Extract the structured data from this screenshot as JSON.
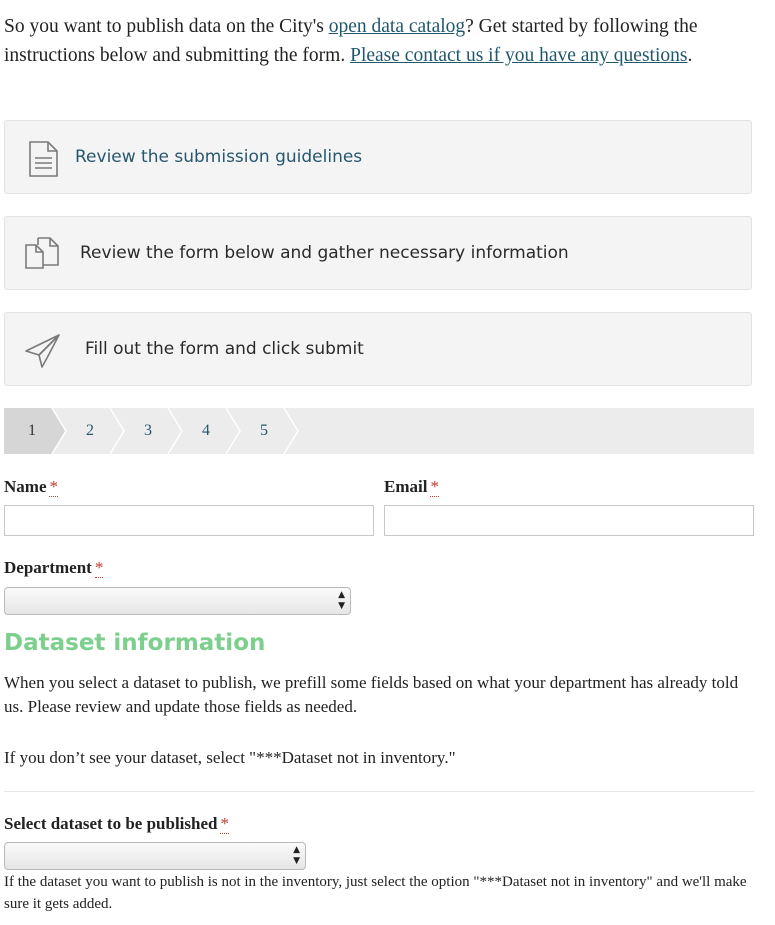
{
  "intro": {
    "text_before": "So you want to publish data on the City's ",
    "catalog_link": "open data catalog",
    "text_middle": "? Get started by following the instructions below and submitting the form. ",
    "contact_link": "Please contact us if you have any questions",
    "text_end": "."
  },
  "steps": [
    {
      "label": "Review the submission guidelines",
      "icon": "document-icon"
    },
    {
      "label": "Review the form below and gather necessary information",
      "icon": "copy-pages-icon"
    },
    {
      "label": "Fill out the form and click submit",
      "icon": "paper-plane-icon"
    }
  ],
  "stepper": {
    "pages": [
      "1",
      "2",
      "3",
      "4",
      "5"
    ],
    "active": "1"
  },
  "form": {
    "name_label": "Name",
    "email_label": "Email",
    "department_label": "Department",
    "required_mark": "*",
    "name_value": "",
    "email_value": "",
    "department_value": ""
  },
  "dataset": {
    "heading": "Dataset information",
    "description": "When you select a dataset to publish, we prefill some fields based on what your department has already told us. Please review and update those fields as needed.",
    "not_found_note": "If you don’t see your dataset, select \"***Dataset not in inventory.\"",
    "select_label": "Select dataset to be published",
    "select_value": "",
    "help_text": "If the dataset you want to publish is not in the inventory, just select the option \"***Dataset not in inventory\" and we'll make sure it gets added."
  },
  "colors": {
    "link": "#21576b",
    "heading": "#7ccf8c",
    "required": "#c0392b",
    "card_bg": "#f4f4f4"
  }
}
